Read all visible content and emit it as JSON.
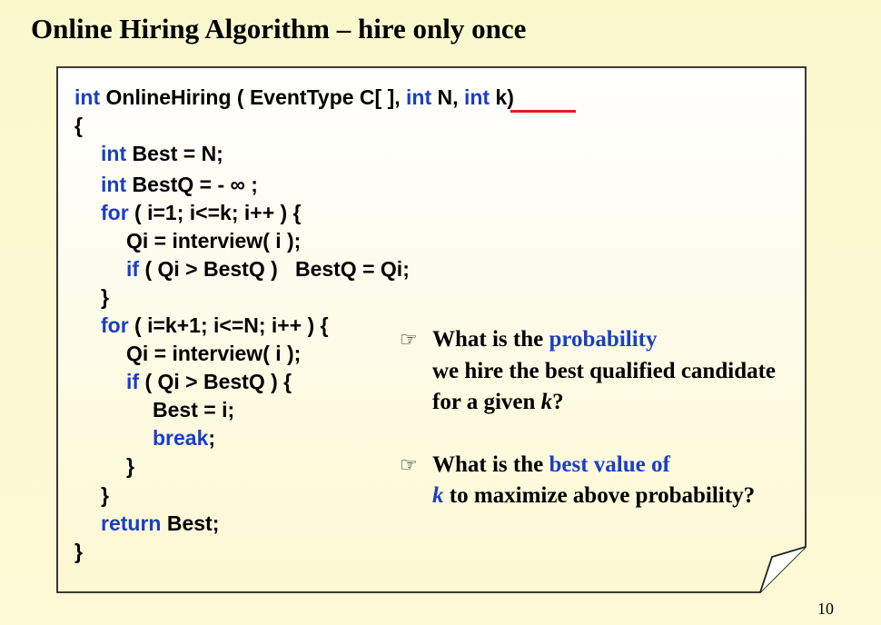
{
  "slide": {
    "title": "Online Hiring Algorithm – hire only once",
    "page_number": "10"
  },
  "code": {
    "sig_int1": "int",
    "sig_func": " OnlineHiring ( EventType C[ ], ",
    "sig_int2": "int",
    "sig_n": " N, ",
    "sig_int3": "int",
    "sig_k": " k)",
    "open_brace": "{",
    "l1_kw": "int",
    "l1_rest": " Best = N;",
    "l2_kw": "int",
    "l2_rest": " BestQ = - ∞ ;",
    "l3_kw": "for",
    "l3_rest": " ( i=1; i<=k; i++ ) {",
    "l4": "Qi = interview( i );",
    "l5_kw": "if",
    "l5_rest": " ( Qi > BestQ )   BestQ = Qi;",
    "l6": "}",
    "l7_kw": "for",
    "l7_rest": " ( i=k+1; i<=N; i++ ) {",
    "l8": "Qi = interview( i );",
    "l9_kw": "if",
    "l9_rest": " ( Qi > BestQ ) {",
    "l10": "Best = i;",
    "l11_kw": "break",
    "l11_rest": ";",
    "l12": "}",
    "l13": "}",
    "l14_kw": "return",
    "l14_rest": " Best;",
    "close_brace": "}"
  },
  "questions": {
    "bullet_icon": "pointing-hand-icon",
    "bullet_glyph": "☞",
    "q1_a": "What is the ",
    "q1_b": "probability",
    "q1_c": "we hire the best qualified candidate for a given ",
    "q1_d": "k",
    "q1_e": "?",
    "q2_a": "What is the ",
    "q2_b": "best value of",
    "q2_c": "k",
    "q2_d": " to maximize above probability?"
  },
  "colors": {
    "background": "#fbf7cd",
    "keyword": "#1a3fc4",
    "highlight_underline": "#e02020",
    "card": "#ffffff"
  }
}
